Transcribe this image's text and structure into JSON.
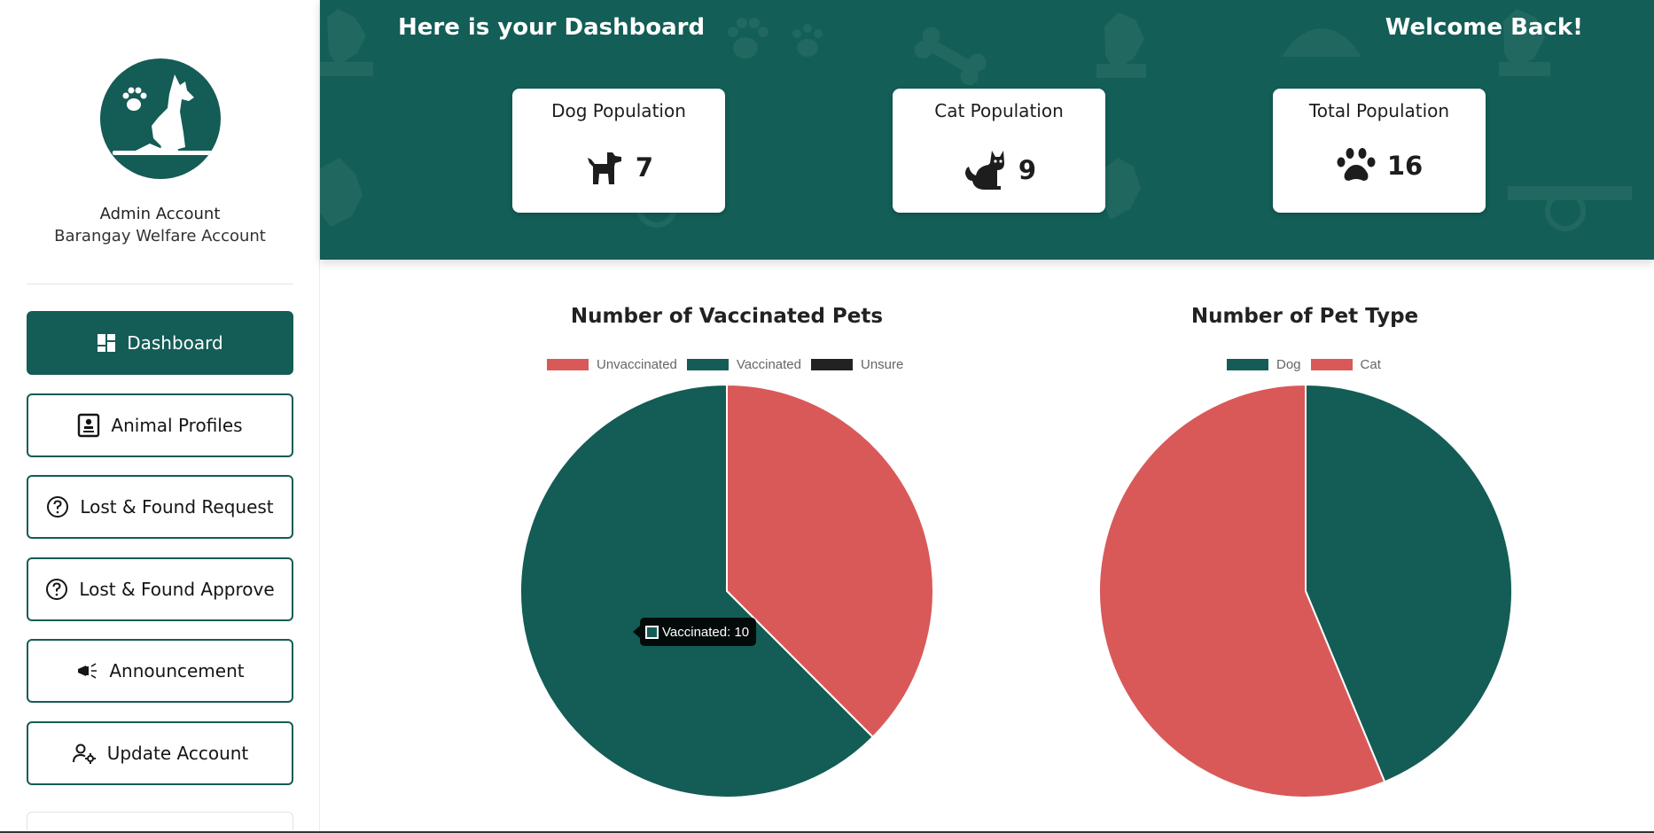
{
  "sidebar": {
    "account_name": "Admin Account",
    "account_sub": "Barangay Welfare Account",
    "items": [
      {
        "label": "Dashboard",
        "icon": "dashboard-icon",
        "active": true
      },
      {
        "label": "Animal Profiles",
        "icon": "profile-card-icon",
        "active": false
      },
      {
        "label": "Lost & Found Request",
        "icon": "question-circle-icon",
        "active": false
      },
      {
        "label": "Lost & Found Approve",
        "icon": "question-circle-icon",
        "active": false
      },
      {
        "label": "Announcement",
        "icon": "megaphone-icon",
        "active": false
      },
      {
        "label": "Update Account",
        "icon": "user-gear-icon",
        "active": false
      }
    ]
  },
  "header": {
    "title": "Here is your Dashboard",
    "welcome": "Welcome Back!",
    "stats": [
      {
        "label": "Dog Population",
        "value": "7",
        "icon": "dog-icon"
      },
      {
        "label": "Cat Population",
        "value": "9",
        "icon": "cat-icon"
      },
      {
        "label": "Total Population",
        "value": "16",
        "icon": "paw-icon"
      }
    ]
  },
  "colors": {
    "brand": "#145c56",
    "red": "#d95959",
    "dark": "#222222"
  },
  "tooltip": {
    "text": "Vaccinated: 10"
  },
  "chart_data": [
    {
      "type": "pie",
      "title": "Number of Vaccinated Pets",
      "labels": [
        "Unvaccinated",
        "Vaccinated",
        "Unsure"
      ],
      "values": [
        6,
        10,
        0
      ],
      "colors": [
        "#d95959",
        "#145c56",
        "#222222"
      ],
      "legend": "top"
    },
    {
      "type": "pie",
      "title": "Number of Pet Type",
      "labels": [
        "Dog",
        "Cat"
      ],
      "values": [
        7,
        9
      ],
      "colors": [
        "#145c56",
        "#d95959"
      ],
      "legend": "top"
    }
  ]
}
